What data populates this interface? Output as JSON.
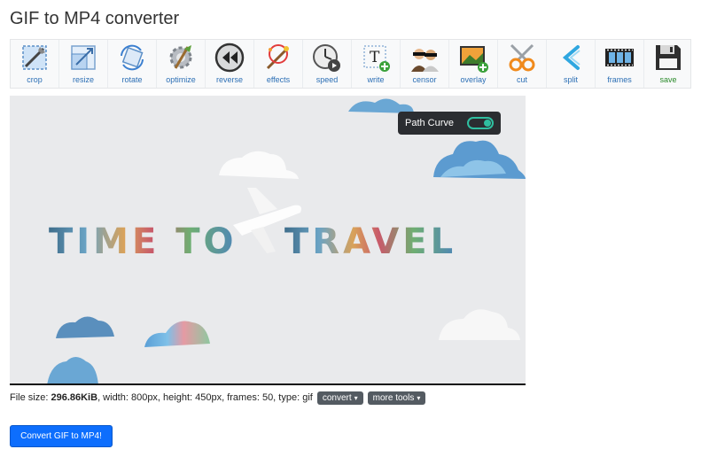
{
  "page": {
    "title": "GIF to MP4 converter"
  },
  "toolbar": {
    "items": [
      {
        "label": "crop",
        "icon": "crop-icon"
      },
      {
        "label": "resize",
        "icon": "resize-icon"
      },
      {
        "label": "rotate",
        "icon": "rotate-icon"
      },
      {
        "label": "optimize",
        "icon": "optimize-icon"
      },
      {
        "label": "reverse",
        "icon": "reverse-icon"
      },
      {
        "label": "effects",
        "icon": "effects-icon"
      },
      {
        "label": "speed",
        "icon": "speed-icon"
      },
      {
        "label": "write",
        "icon": "write-icon"
      },
      {
        "label": "censor",
        "icon": "censor-icon"
      },
      {
        "label": "overlay",
        "icon": "overlay-icon"
      },
      {
        "label": "cut",
        "icon": "cut-icon"
      },
      {
        "label": "split",
        "icon": "split-icon"
      },
      {
        "label": "frames",
        "icon": "frames-icon"
      },
      {
        "label": "save",
        "icon": "save-icon"
      }
    ]
  },
  "preview": {
    "headline_left": "TIME TO",
    "headline_right": "TRAVEL",
    "overlay_label": "Path Curve",
    "toggle_on": true
  },
  "file_info": {
    "size_prefix": "File size: ",
    "size_value": "296.86KiB",
    "details": ", width: 800px, height: 450px, frames: 50, type: gif",
    "convert_label": "convert",
    "more_tools_label": "more tools"
  },
  "actions": {
    "convert_button": "Convert GIF to MP4!"
  },
  "colors": {
    "primary": "#0d6efd",
    "link": "#2c6fb5",
    "save_green": "#2a8a2a",
    "toggle_accent": "#2fbfa0"
  }
}
